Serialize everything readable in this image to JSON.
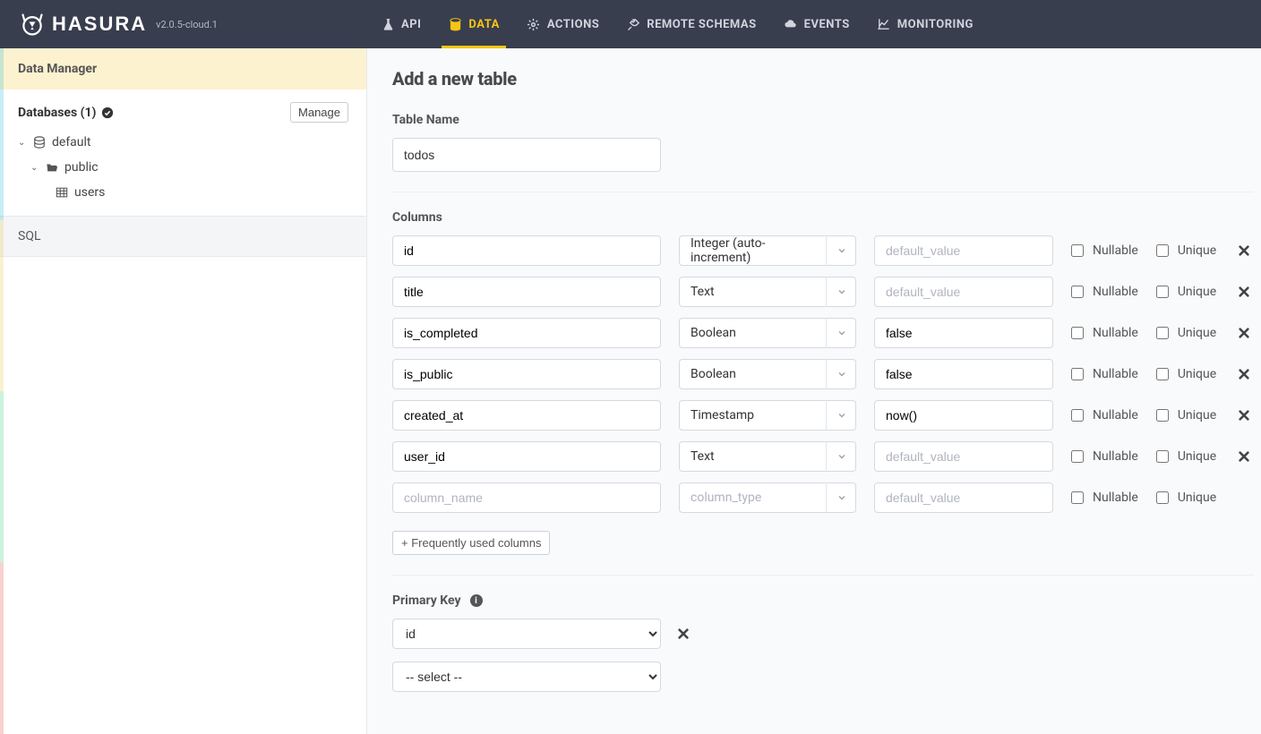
{
  "brand": "HASURA",
  "version": "v2.0.5-cloud.1",
  "nav": [
    {
      "label": "API",
      "icon": "flask"
    },
    {
      "label": "DATA",
      "icon": "database",
      "active": true
    },
    {
      "label": "ACTIONS",
      "icon": "bolt"
    },
    {
      "label": "REMOTE SCHEMAS",
      "icon": "plug"
    },
    {
      "label": "EVENTS",
      "icon": "cloud"
    },
    {
      "label": "MONITORING",
      "icon": "chart"
    }
  ],
  "sidebar": {
    "title": "Data Manager",
    "db_header": "Databases (1)",
    "manage_label": "Manage",
    "tree": {
      "db": "default",
      "schema": "public",
      "tables": [
        "users"
      ]
    },
    "sql_label": "SQL"
  },
  "page": {
    "title": "Add a new table",
    "table_name_label": "Table Name",
    "table_name_value": "todos",
    "columns_label": "Columns",
    "name_placeholder": "column_name",
    "type_placeholder": "column_type",
    "default_placeholder": "default_value",
    "nullable_label": "Nullable",
    "unique_label": "Unique",
    "freq_label": "+ Frequently used columns",
    "columns": [
      {
        "name": "id",
        "type": "Integer (auto-increment)",
        "default": ""
      },
      {
        "name": "title",
        "type": "Text",
        "default": ""
      },
      {
        "name": "is_completed",
        "type": "Boolean",
        "default": "false"
      },
      {
        "name": "is_public",
        "type": "Boolean",
        "default": "false"
      },
      {
        "name": "created_at",
        "type": "Timestamp",
        "default": "now()"
      },
      {
        "name": "user_id",
        "type": "Text",
        "default": ""
      },
      {
        "name": "",
        "type": "",
        "default": "",
        "blank": true
      }
    ],
    "pk_label": "Primary Key",
    "pk_rows": [
      {
        "value": "id",
        "removable": true
      },
      {
        "value": "-- select --",
        "removable": false
      }
    ]
  }
}
